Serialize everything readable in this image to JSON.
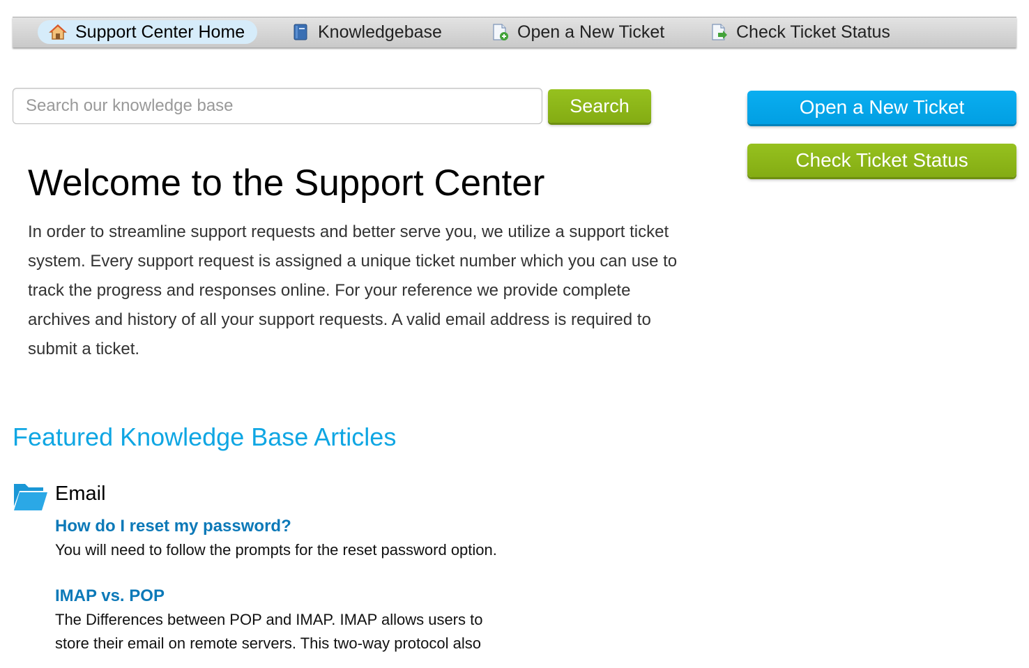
{
  "nav": {
    "items": [
      {
        "label": "Support Center Home",
        "icon": "home-icon",
        "active": true
      },
      {
        "label": "Knowledgebase",
        "icon": "book-icon",
        "active": false
      },
      {
        "label": "Open a New Ticket",
        "icon": "new-ticket-icon",
        "active": false
      },
      {
        "label": "Check Ticket Status",
        "icon": "ticket-status-icon",
        "active": false
      }
    ]
  },
  "search": {
    "placeholder": "Search our knowledge base",
    "value": "",
    "button_label": "Search"
  },
  "sidebar": {
    "open_ticket_label": "Open a New Ticket",
    "check_status_label": "Check Ticket Status"
  },
  "welcome": {
    "title": "Welcome to the Support Center",
    "body": "In order to streamline support requests and better serve you, we utilize a support ticket system. Every support request is assigned a unique ticket number which you can use to track the progress and responses online. For your reference we provide complete archives and history of all your support requests. A valid email address is required to submit a ticket."
  },
  "featured": {
    "heading": "Featured Knowledge Base Articles",
    "category": {
      "name": "Email",
      "icon": "folder-open-icon",
      "articles": [
        {
          "title": "How do I reset my password?",
          "excerpt": "You will need to follow the prompts for the reset password option."
        },
        {
          "title": "IMAP vs. POP",
          "excerpt": "The Differences between POP and IMAP. IMAP allows users to store their email on remote servers. This two-way protocol also"
        }
      ]
    }
  },
  "colors": {
    "accent_blue": "#0fa6e3",
    "button_blue": "#019fe3",
    "button_green": "#8bb519",
    "link_blue": "#0c79b8"
  }
}
